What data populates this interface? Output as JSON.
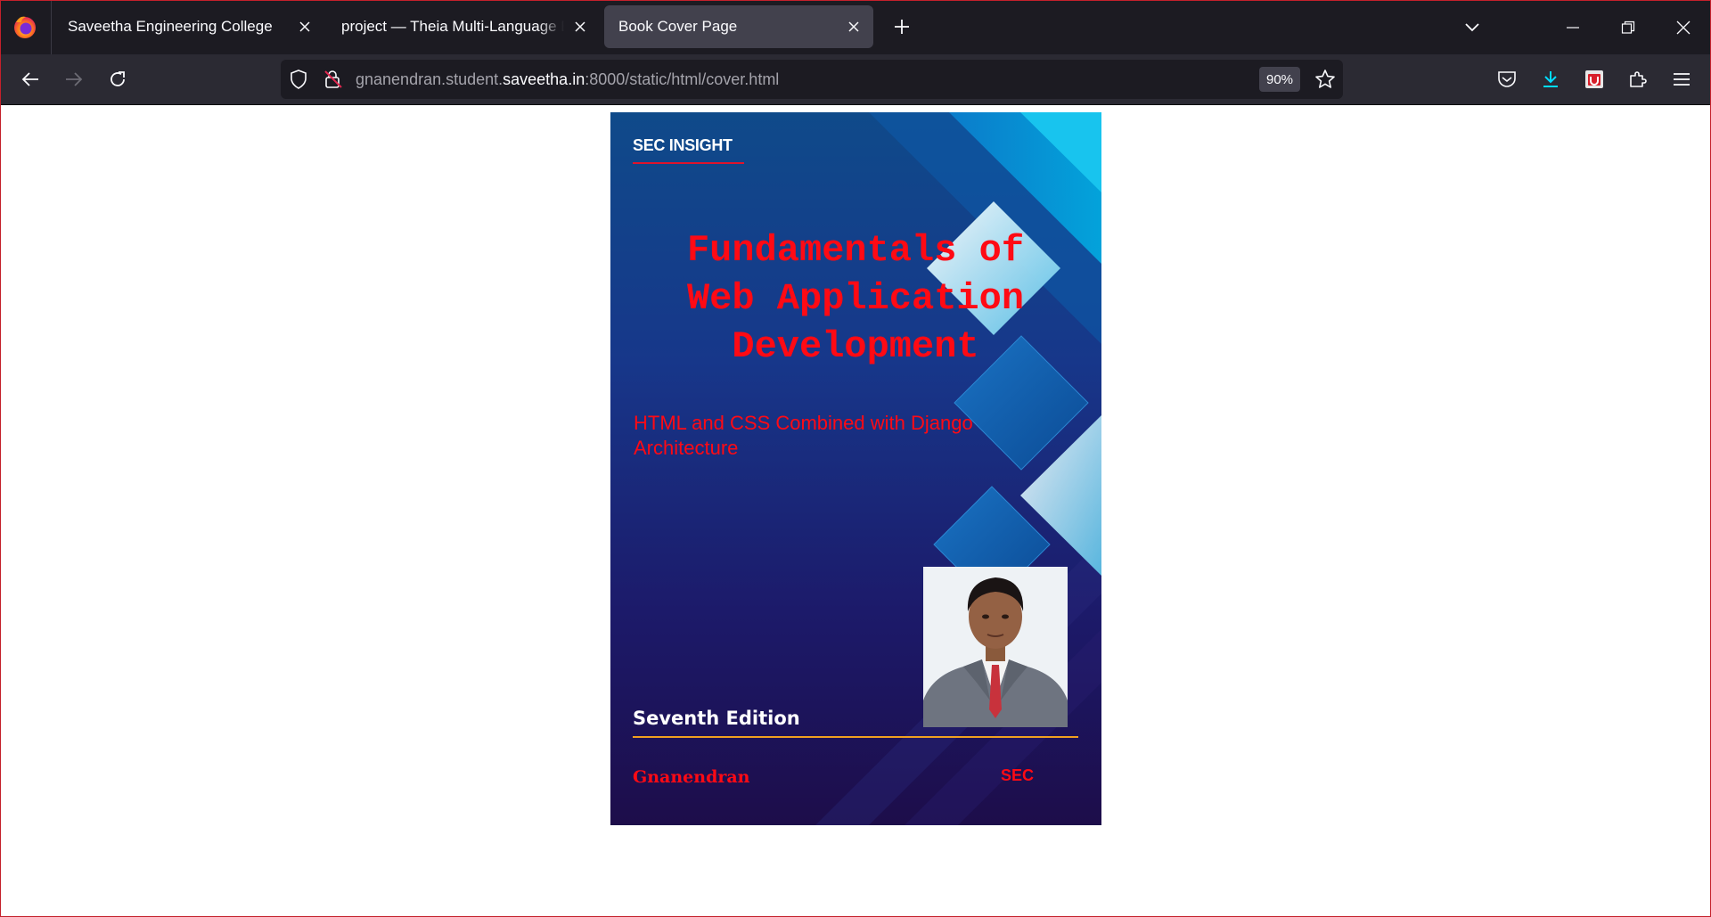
{
  "browser": {
    "tabs": [
      {
        "title": "Saveetha Engineering College",
        "active": false
      },
      {
        "title": "project — Theia Multi-Language Example",
        "active": false
      },
      {
        "title": "Book Cover Page",
        "active": true
      }
    ],
    "url": {
      "prefix": "gnanendran.student.",
      "domain": "saveetha.in",
      "suffix": ":8000/static/html/cover.html"
    },
    "zoom": "90%",
    "icons": {
      "logo": "firefox-logo-icon",
      "new_tab": "plus-icon",
      "tab_list": "chevron-down-icon",
      "minimize": "minimize-icon",
      "restore": "restore-icon",
      "close": "close-icon",
      "back": "arrow-left-icon",
      "forward": "arrow-right-icon",
      "reload": "reload-icon",
      "shield": "tracking-protection-shield-icon",
      "lock": "insecure-lock-icon",
      "bookmark": "star-icon",
      "pocket": "pocket-icon",
      "downloads": "download-icon",
      "extension_badge": "extension-badge-icon",
      "extensions": "puzzle-piece-icon",
      "menu": "hamburger-menu-icon"
    },
    "colors": {
      "chrome_dark": "#1c1b22",
      "toolbar": "#2b2a33",
      "active_tab": "#42414d",
      "download_accent": "#00ddff"
    }
  },
  "cover": {
    "brand": "SEC INSIGHT",
    "title_lines": [
      "Fundamentals of",
      "Web Application",
      "Development"
    ],
    "subtitle_lines": [
      "HTML and CSS Combined with Django",
      "Architecture"
    ],
    "edition": "Seventh Edition",
    "author": "Gnanendran",
    "publisher": "SEC",
    "photo": "author-portrait",
    "colors": {
      "title_red": "#ff0a14",
      "brand_underline": "#e0142b",
      "edition_rule": "#f0a020",
      "background_top": "#0f4a8a",
      "background_bottom": "#1d0d4a"
    }
  }
}
